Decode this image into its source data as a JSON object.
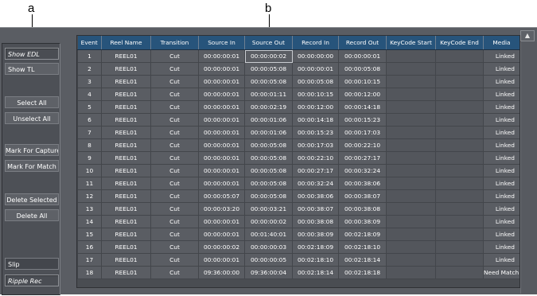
{
  "callouts": {
    "a": "a",
    "b": "b"
  },
  "sidebar": {
    "show_edl": "Show EDL",
    "show_tl": "Show TL",
    "select_all": "Select All",
    "unselect_all": "Unselect All",
    "mark_for_capture": "Mark For Capture",
    "mark_for_match": "Mark For Match",
    "delete_selected": "Delete Selected",
    "delete_all": "Delete All",
    "slip": "Slip",
    "ripple_rec": "Ripple Rec"
  },
  "scroll_up_icon": "▲",
  "table": {
    "headers": [
      "Event",
      "Reel Name",
      "Transition",
      "Source In",
      "Source Out",
      "Record In",
      "Record Out",
      "KeyCode Start",
      "KeyCode End",
      "Media"
    ],
    "rows": [
      [
        "1",
        "REEL01",
        "Cut",
        "00:00:00:01",
        "00:00:00:02",
        "00:00:00:00",
        "00:00:00:01",
        "",
        "",
        "Linked"
      ],
      [
        "2",
        "REEL01",
        "Cut",
        "00:00:00:01",
        "00:00:05:08",
        "00:00:00:01",
        "00:00:05:08",
        "",
        "",
        "Linked"
      ],
      [
        "3",
        "REEL01",
        "Cut",
        "00:00:00:01",
        "00:00:05:08",
        "00:00:05:08",
        "00:00:10:15",
        "",
        "",
        "Linked"
      ],
      [
        "4",
        "REEL01",
        "Cut",
        "00:00:00:01",
        "00:00:01:11",
        "00:00:10:15",
        "00:00:12:00",
        "",
        "",
        "Linked"
      ],
      [
        "5",
        "REEL01",
        "Cut",
        "00:00:00:01",
        "00:00:02:19",
        "00:00:12:00",
        "00:00:14:18",
        "",
        "",
        "Linked"
      ],
      [
        "6",
        "REEL01",
        "Cut",
        "00:00:00:01",
        "00:00:01:06",
        "00:00:14:18",
        "00:00:15:23",
        "",
        "",
        "Linked"
      ],
      [
        "7",
        "REEL01",
        "Cut",
        "00:00:00:01",
        "00:00:01:06",
        "00:00:15:23",
        "00:00:17:03",
        "",
        "",
        "Linked"
      ],
      [
        "8",
        "REEL01",
        "Cut",
        "00:00:00:01",
        "00:00:05:08",
        "00:00:17:03",
        "00:00:22:10",
        "",
        "",
        "Linked"
      ],
      [
        "9",
        "REEL01",
        "Cut",
        "00:00:00:01",
        "00:00:05:08",
        "00:00:22:10",
        "00:00:27:17",
        "",
        "",
        "Linked"
      ],
      [
        "10",
        "REEL01",
        "Cut",
        "00:00:00:01",
        "00:00:05:08",
        "00:00:27:17",
        "00:00:32:24",
        "",
        "",
        "Linked"
      ],
      [
        "11",
        "REEL01",
        "Cut",
        "00:00:00:01",
        "00:00:05:08",
        "00:00:32:24",
        "00:00:38:06",
        "",
        "",
        "Linked"
      ],
      [
        "12",
        "REEL01",
        "Cut",
        "00:00:05:07",
        "00:00:05:08",
        "00:00:38:06",
        "00:00:38:07",
        "",
        "",
        "Linked"
      ],
      [
        "13",
        "REEL01",
        "Cut",
        "00:00:03:20",
        "00:00:03:21",
        "00:00:38:07",
        "00:00:38:08",
        "",
        "",
        "Linked"
      ],
      [
        "14",
        "REEL01",
        "Cut",
        "00:00:00:01",
        "00:00:00:02",
        "00:00:38:08",
        "00:00:38:09",
        "",
        "",
        "Linked"
      ],
      [
        "15",
        "REEL01",
        "Cut",
        "00:00:00:01",
        "00:01:40:01",
        "00:00:38:09",
        "00:02:18:09",
        "",
        "",
        "Linked"
      ],
      [
        "16",
        "REEL01",
        "Cut",
        "00:00:00:02",
        "00:00:00:03",
        "00:02:18:09",
        "00:02:18:10",
        "",
        "",
        "Linked"
      ],
      [
        "17",
        "REEL01",
        "Cut",
        "00:00:00:01",
        "00:00:00:05",
        "00:02:18:10",
        "00:02:18:14",
        "",
        "",
        "Linked"
      ],
      [
        "18",
        "REEL01",
        "Cut",
        "09:36:00:00",
        "09:36:00:04",
        "00:02:18:14",
        "00:02:18:18",
        "",
        "",
        "Need Match"
      ]
    ]
  }
}
